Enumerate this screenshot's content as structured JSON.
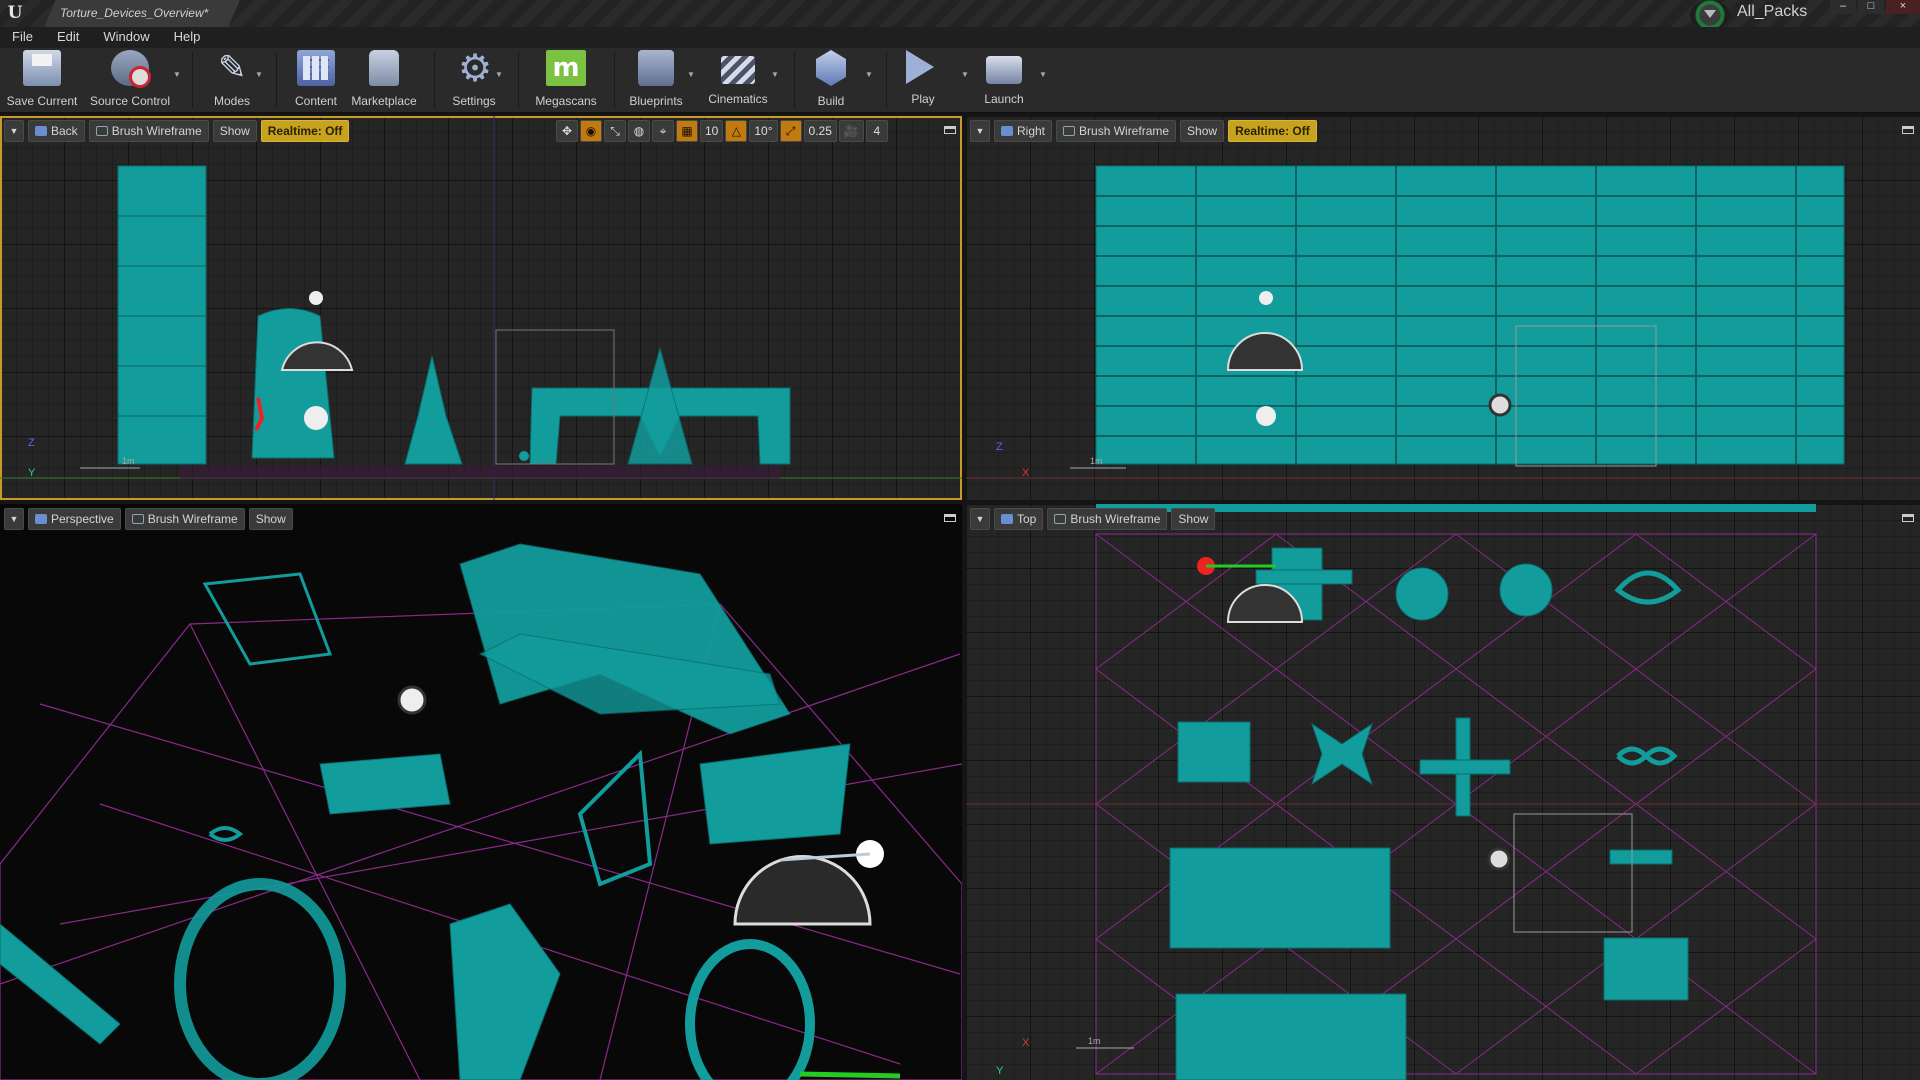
{
  "window": {
    "tab_title": "Torture_Devices_Overview*",
    "project_label": "All_Packs",
    "controls": [
      "–",
      "□",
      "×"
    ]
  },
  "menu": [
    "File",
    "Edit",
    "Window",
    "Help"
  ],
  "toolbar": {
    "save": "Save Current",
    "source_control": "Source Control",
    "modes": "Modes",
    "content": "Content",
    "marketplace": "Marketplace",
    "settings": "Settings",
    "megascans": "Megascans",
    "megascans_glyph": "m",
    "blueprints": "Blueprints",
    "cinematics": "Cinematics",
    "build": "Build",
    "play": "Play",
    "launch": "Launch"
  },
  "viewports": {
    "back": {
      "view": "Back",
      "mode": "Brush Wireframe",
      "show": "Show",
      "realtime": "Realtime: Off",
      "snap_grid": "10",
      "snap_rot": "10°",
      "snap_scale": "0.25",
      "camera_speed": "4",
      "scale": "1m",
      "axis_y": "Y",
      "axis_z": "Z"
    },
    "right": {
      "view": "Right",
      "mode": "Brush Wireframe",
      "show": "Show",
      "realtime": "Realtime: Off",
      "scale": "1m",
      "axis_x": "X",
      "axis_z": "Z"
    },
    "perspective": {
      "view": "Perspective",
      "mode": "Brush Wireframe",
      "show": "Show"
    },
    "top": {
      "view": "Top",
      "mode": "Brush Wireframe",
      "show": "Show",
      "scale": "1m",
      "axis_x": "X",
      "axis_y": "Y"
    }
  },
  "colors": {
    "wireframe": "#1a9a9a",
    "grid_magenta": "#8a2a8a",
    "active_border": "#c89a2a",
    "realtime_badge": "#c7a21e"
  }
}
